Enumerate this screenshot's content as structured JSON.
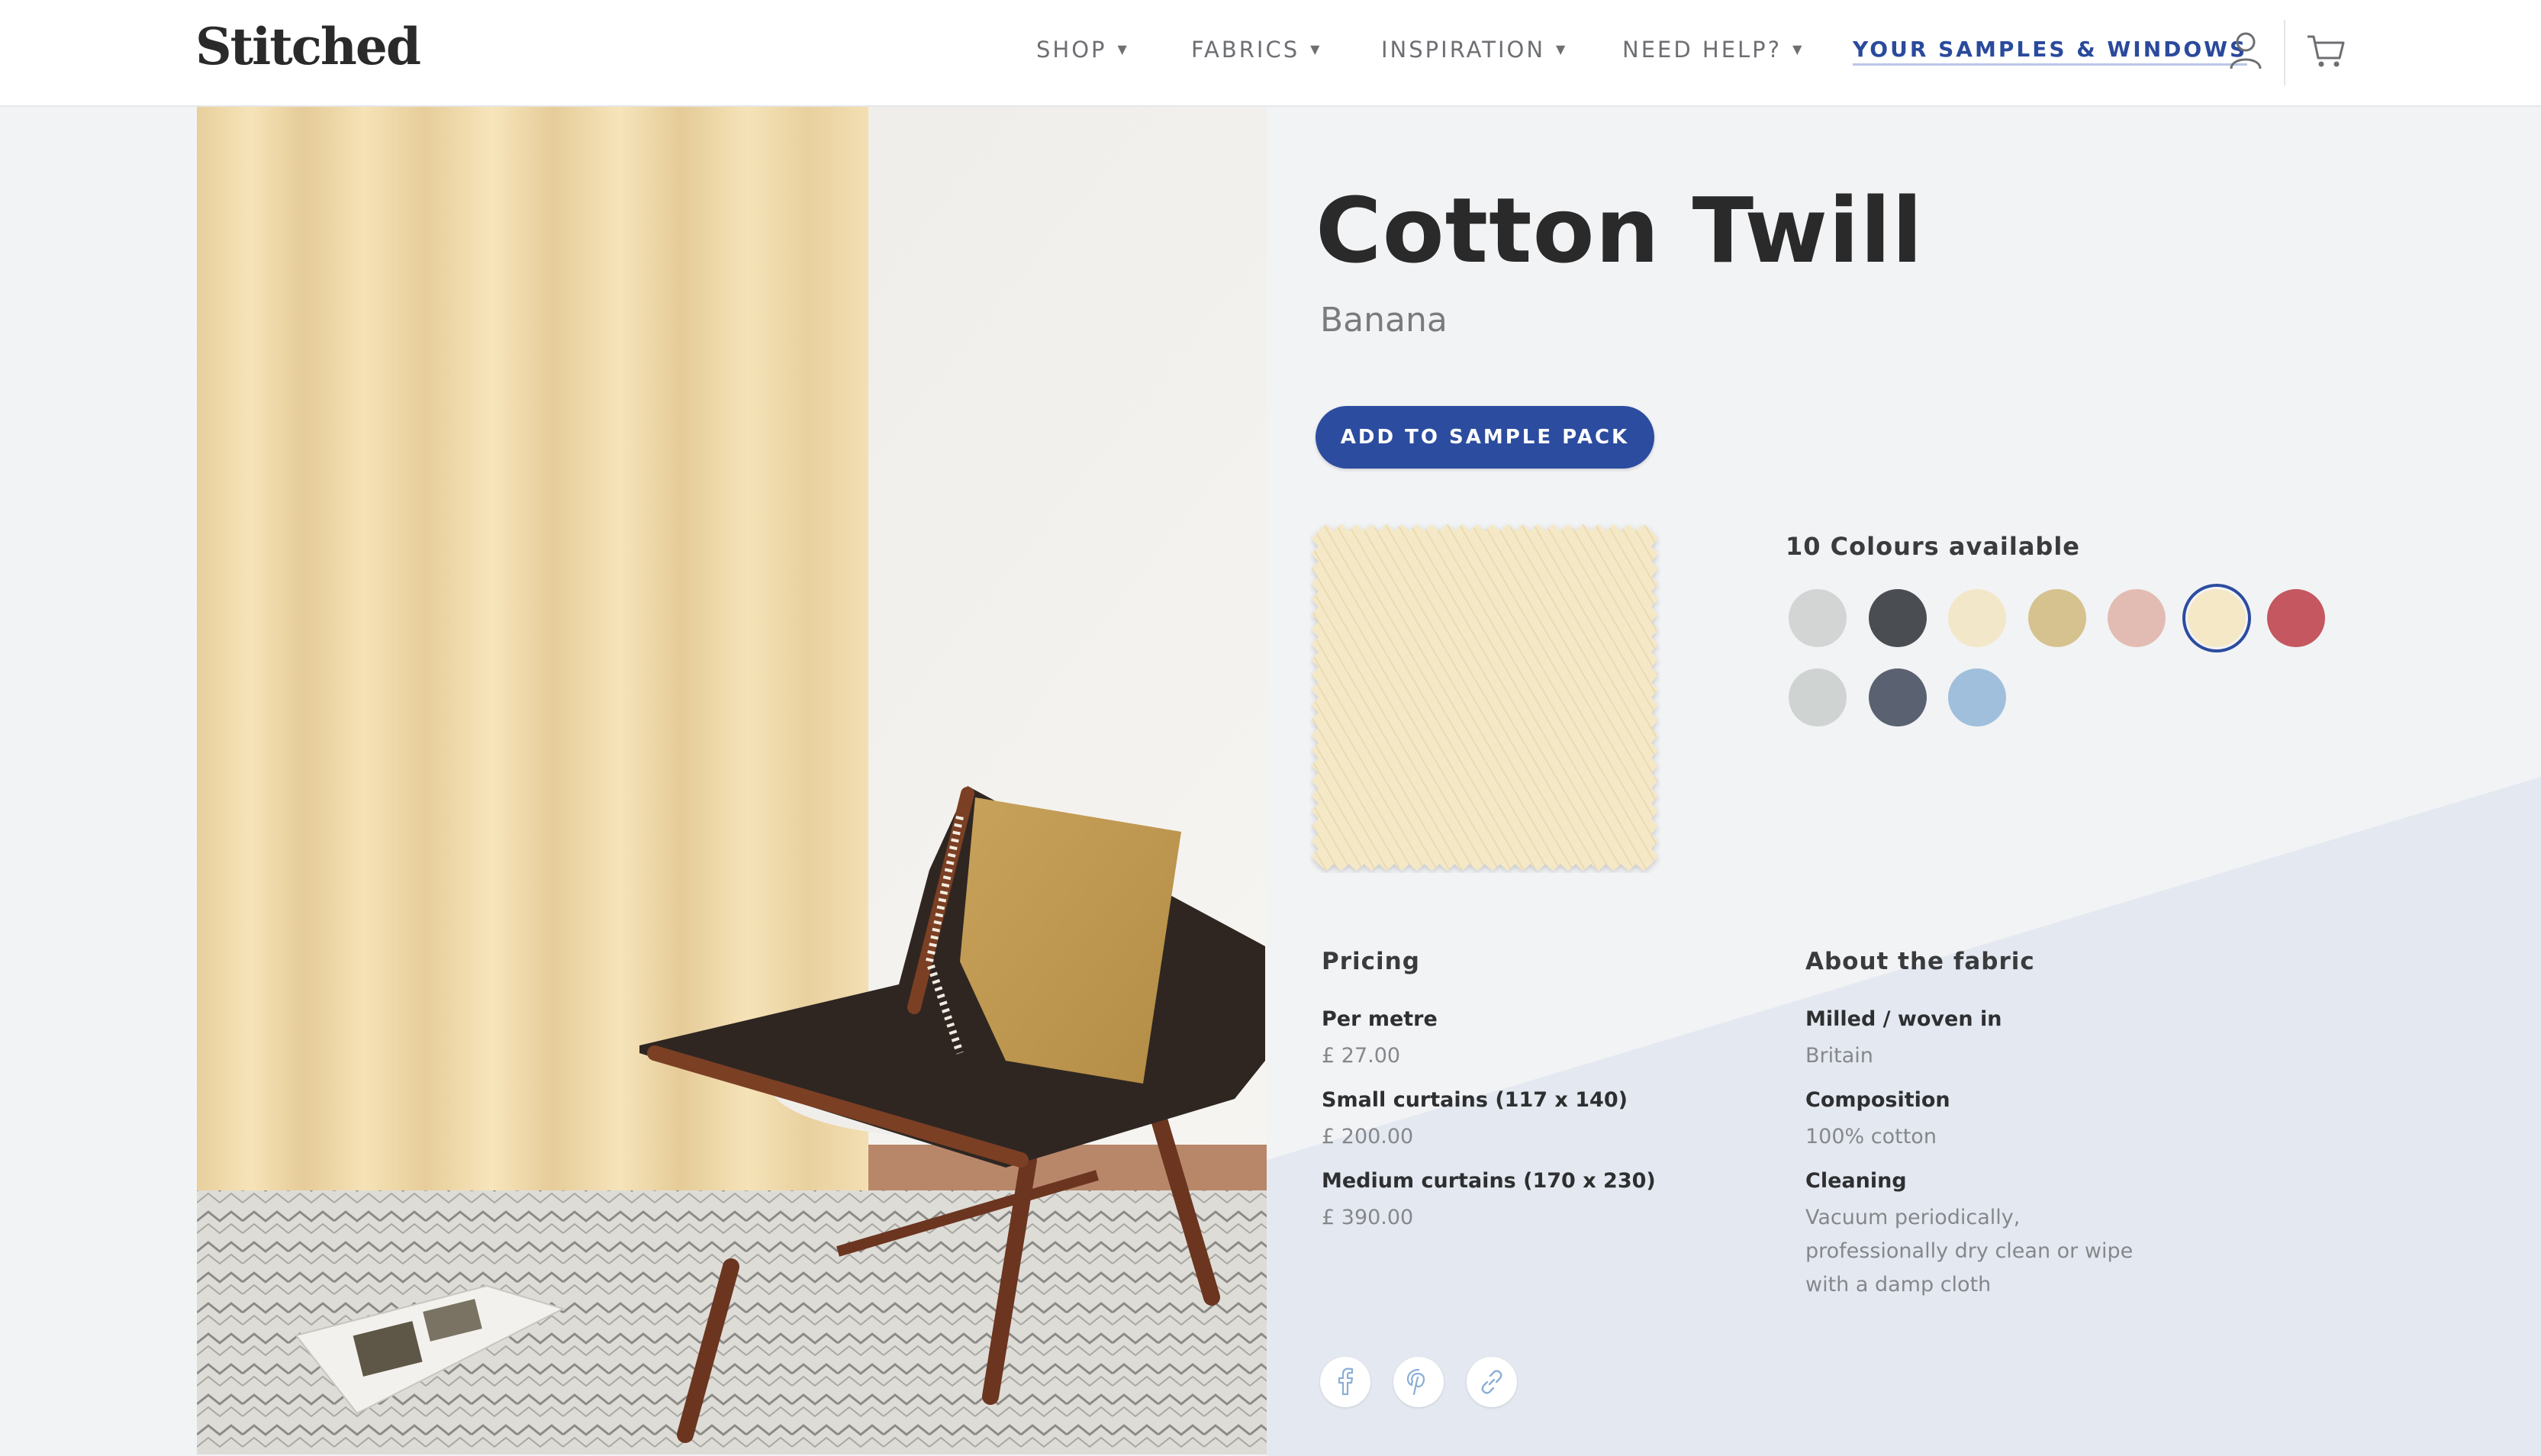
{
  "brand": {
    "logo_text": "Stitched"
  },
  "nav": {
    "items": [
      {
        "label": "SHOP"
      },
      {
        "label": "FABRICS"
      },
      {
        "label": "INSPIRATION"
      },
      {
        "label": "NEED HELP?"
      }
    ],
    "caret_glyph": "▼",
    "samples_link": "YOUR SAMPLES & WINDOWS",
    "account_icon": "user-icon",
    "cart_icon": "cart-icon"
  },
  "product": {
    "name": "Cotton Twill",
    "colour": "Banana",
    "cta_label": "ADD TO SAMPLE PACK",
    "swatch_color": "#f5e8c6"
  },
  "colours": {
    "label": "10 Colours available",
    "selected_index": 5,
    "swatches": [
      {
        "color": "#d3d5d4"
      },
      {
        "color": "#4a4d52"
      },
      {
        "color": "#f2e7c8"
      },
      {
        "color": "#d6c28e"
      },
      {
        "color": "#e2bcb3"
      },
      {
        "color": "#f5e8c6"
      },
      {
        "color": "#c4575f"
      },
      {
        "color": "#cfd3d2"
      },
      {
        "color": "#5a6170"
      },
      {
        "color": "#a0bfdc"
      }
    ]
  },
  "pricing": {
    "title": "Pricing",
    "rows": [
      {
        "label": "Per metre",
        "value": "£ 27.00"
      },
      {
        "label": "Small curtains (117 x 140)",
        "value": "£ 200.00"
      },
      {
        "label": "Medium curtains (170 x 230)",
        "value": "£ 390.00"
      }
    ]
  },
  "about": {
    "title": "About the fabric",
    "rows": [
      {
        "label": "Milled / woven in",
        "value": "Britain"
      },
      {
        "label": "Composition",
        "value": "100% cotton"
      },
      {
        "label": "Cleaning",
        "value": "Vacuum periodically, professionally dry clean or wipe with a damp cloth"
      }
    ]
  },
  "share": {
    "icons": [
      "facebook-icon",
      "pinterest-icon",
      "link-icon"
    ],
    "icon_color": "#8aaed6"
  },
  "colors": {
    "accent": "#2c4c9f",
    "background": "#f2f3f5",
    "diagonal_panel": "#e4e9f1"
  }
}
